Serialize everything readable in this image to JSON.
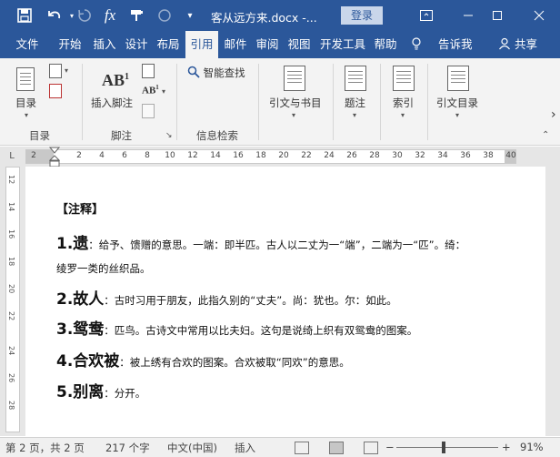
{
  "titlebar": {
    "title": "客从远方来.docx -...",
    "login": "登录",
    "icons": [
      "save-icon",
      "undo-icon",
      "redo-icon",
      "fx-icon",
      "format-painter-icon",
      "circle-icon",
      "customize-dropdown-icon"
    ]
  },
  "tabs": [
    "文件",
    "开始",
    "插入",
    "设计",
    "布局",
    "引用",
    "邮件",
    "审阅",
    "视图",
    "开发工具",
    "帮助"
  ],
  "active_tab": "引用",
  "tell_me": "告诉我",
  "share": "共享",
  "ribbon": {
    "toc_label": "目录",
    "toc_group": "目录",
    "insert_footnote": "插入脚注",
    "footnote_group": "脚注",
    "smart_lookup": "智能查找",
    "research_group": "信息检索",
    "citations": "引文与书目",
    "captions": "题注",
    "index": "索引",
    "toa": "引文目录"
  },
  "ruler": {
    "ticks": [
      "2",
      "2",
      "4",
      "6",
      "8",
      "10",
      "12",
      "14",
      "16",
      "18",
      "20",
      "22",
      "24",
      "26",
      "28",
      "30",
      "32",
      "34",
      "36",
      "38",
      "40"
    ],
    "corner": "L"
  },
  "vruler": [
    "12",
    "14",
    "16",
    "18",
    "20",
    "22",
    "24",
    "26",
    "28"
  ],
  "document": {
    "heading": "【注释】",
    "items": [
      {
        "num": "1.遗",
        "def": "：给予、馈赠的意思。一端：即半匹。古人以二丈为一“端”，二端为一“匹”。绮："
      },
      {
        "num": "",
        "def": "绫罗一类的丝织品。"
      },
      {
        "num": "2.故人",
        "def": "：古时习用于朋友，此指久别的“丈夫”。尚：犹也。尔：如此。"
      },
      {
        "num": "3.鸳鸯",
        "def": "：匹鸟。古诗文中常用以比夫妇。这句是说绮上织有双鸳鸯的图案。"
      },
      {
        "num": "4.合欢被",
        "def": "：被上绣有合欢的图案。合欢被取“同欢”的意思。"
      },
      {
        "num": "5.别离",
        "def": "：分开。"
      }
    ]
  },
  "status": {
    "page": "第 2 页，共 2 页",
    "words": "217 个字",
    "lang": "中文(中国)",
    "mode": "插入",
    "zoom": "91%",
    "zoom_minus": "−",
    "zoom_plus": "+"
  },
  "colors": {
    "accent": "#2b579a",
    "ribbon_bg": "#f3f3f3",
    "doc_bg": "#e6e6e6"
  }
}
